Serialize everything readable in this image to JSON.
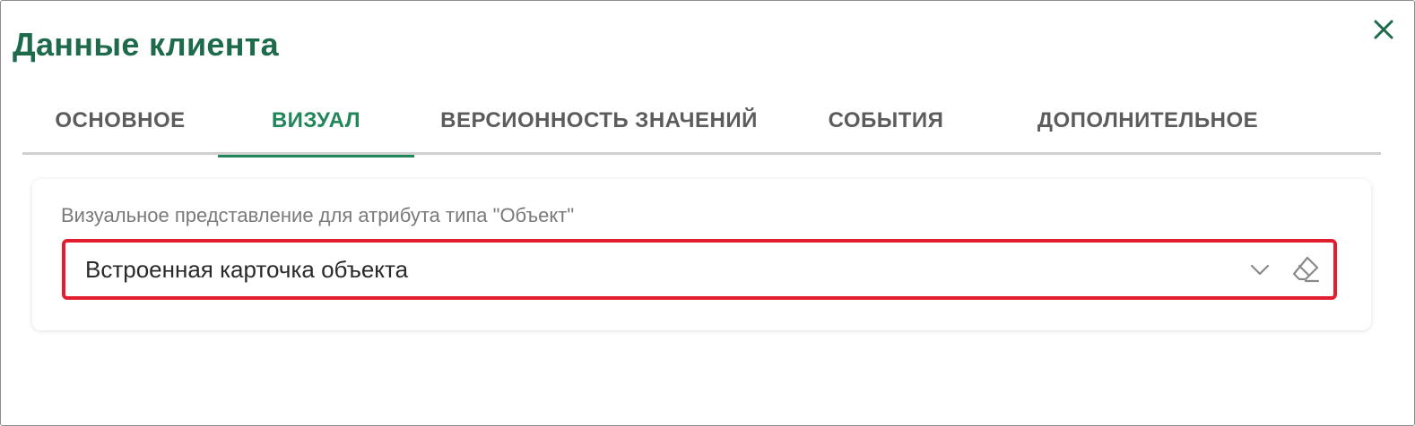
{
  "dialog": {
    "title": "Данные клиента",
    "close_icon": "close-icon"
  },
  "tabs": [
    {
      "label": "ОСНОВНОЕ",
      "active": false
    },
    {
      "label": "ВИЗУАЛ",
      "active": true
    },
    {
      "label": "ВЕРСИОННОСТЬ ЗНАЧЕНИЙ",
      "active": false
    },
    {
      "label": "СОБЫТИЯ",
      "active": false
    },
    {
      "label": "ДОПОЛНИТЕЛЬНОЕ",
      "active": false
    }
  ],
  "visual": {
    "field_label": "Визуальное представление для атрибута типа \"Объект\"",
    "select_value": "Встроенная карточка объекта",
    "dropdown_icon": "chevron-down-icon",
    "clear_icon": "eraser-icon"
  },
  "colors": {
    "accent": "#21875a",
    "title": "#1e6b4c",
    "highlight_border": "#e01e2f"
  }
}
